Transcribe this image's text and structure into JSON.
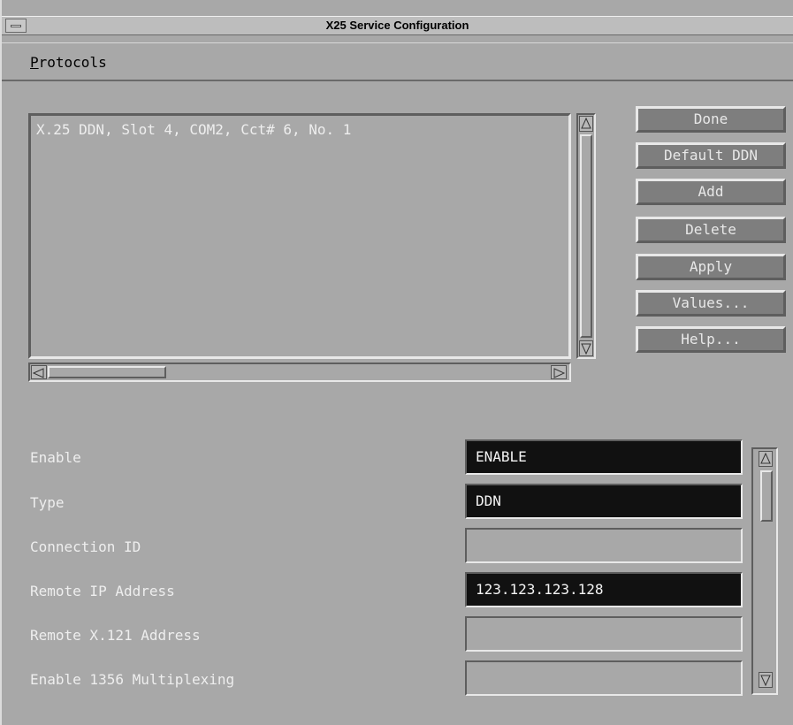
{
  "window": {
    "title": "X25 Service Configuration"
  },
  "menubar": {
    "protocols_underline": "P",
    "protocols_rest": "rotocols"
  },
  "list": {
    "items": [
      "X.25 DDN, Slot 4, COM2, Cct# 6, No. 1"
    ]
  },
  "buttons": {
    "done": "Done",
    "default_ddn": "Default DDN",
    "add": "Add",
    "delete": "Delete",
    "apply": "Apply",
    "values": "Values...",
    "help": "Help..."
  },
  "fields": [
    {
      "label": "Enable",
      "value": "ENABLE"
    },
    {
      "label": "Type",
      "value": "DDN"
    },
    {
      "label": "Connection ID",
      "value": ""
    },
    {
      "label": "Remote IP Address",
      "value": "123.123.123.128"
    },
    {
      "label": "Remote X.121 Address",
      "value": ""
    },
    {
      "label": "Enable 1356 Multiplexing",
      "value": ""
    }
  ]
}
